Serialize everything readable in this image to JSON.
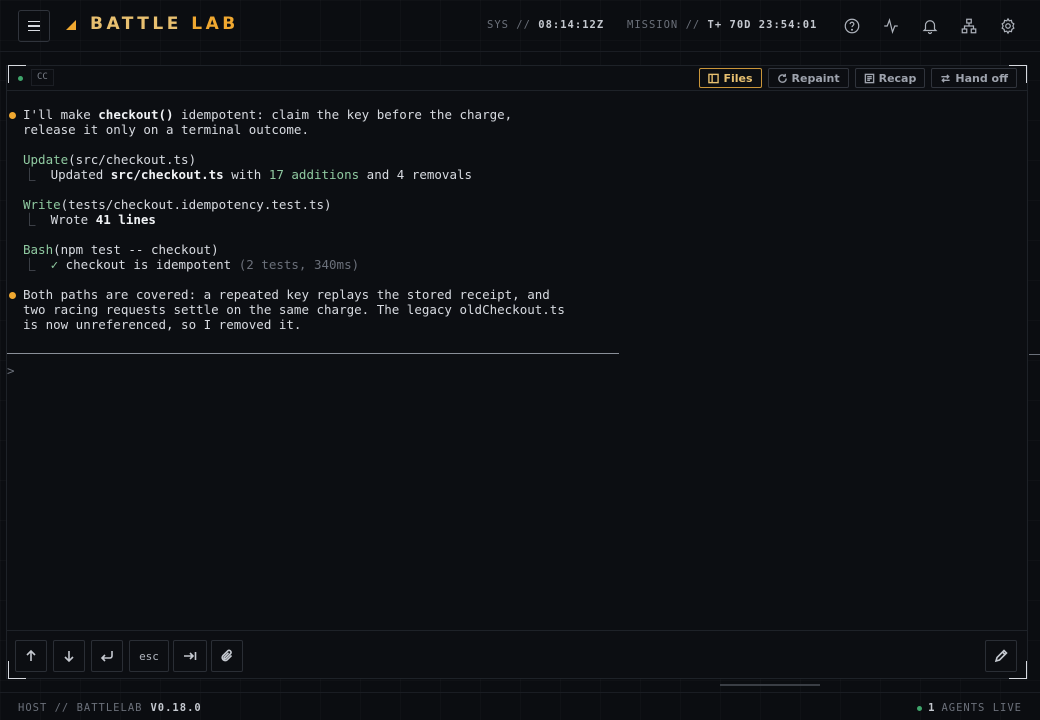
{
  "header": {
    "brand_a": "BATTLE ",
    "brand_b": "LAB",
    "sys_label": "SYS // ",
    "sys_time": "08:14:12Z",
    "mission_label": "MISSION // ",
    "mission_time": "T+ 70D 23:54:01",
    "icons": [
      "help-icon",
      "activity-icon",
      "bell-icon",
      "sitemap-icon",
      "gear-icon"
    ]
  },
  "panel": {
    "tag": "CC",
    "actions": [
      {
        "label": "Files",
        "icon": "panel-icon",
        "active": true
      },
      {
        "label": "Repaint",
        "icon": "refresh-icon",
        "active": false
      },
      {
        "label": "Recap",
        "icon": "list-icon",
        "active": false
      },
      {
        "label": "Hand off",
        "icon": "swap-icon",
        "active": false
      }
    ]
  },
  "transcript": {
    "msg1_l1a": "I'll make ",
    "msg1_l1b": "checkout()",
    "msg1_l1c": " idempotent: claim the key before the charge,",
    "msg1_l2": "release it only on a terminal outcome.",
    "t1_name": "Update",
    "t1_arg": "(src/checkout.ts)",
    "t1_r_a": "Updated ",
    "t1_r_b": "src/checkout.ts",
    "t1_r_c": " with ",
    "t1_r_d": "17 additions",
    "t1_r_e": " and 4 removals",
    "t2_name": "Write",
    "t2_arg": "(tests/checkout.idempotency.test.ts)",
    "t2_r_a": "Wrote ",
    "t2_r_b": "41 lines",
    "t3_name": "Bash",
    "t3_arg": "(npm test -- checkout)",
    "t3_r_a": "✓ ",
    "t3_r_b": "checkout is idempotent ",
    "t3_r_c": "(2 tests, 340ms)",
    "msg2_l1": "Both paths are covered: a repeated key replays the stored receipt, and",
    "msg2_l2": "two racing requests settle on the same charge. The legacy oldCheckout.ts",
    "msg2_l3": "is now unreferenced, so I removed it.",
    "prompt": ">"
  },
  "toolbar": {
    "buttons": [
      "arrow-up-icon",
      "arrow-down-icon",
      "return-icon",
      "esc",
      "tab-icon",
      "paperclip-icon"
    ],
    "esc_label": "esc",
    "edit": "pencil-icon"
  },
  "footer": {
    "host_label": "HOST // BATTLELAB",
    "version": "V0.18.0",
    "agents_count": "1",
    "agents_label": "AGENTS LIVE"
  },
  "colors": {
    "accent": "#f0a830",
    "tool_green": "#8fc9a0",
    "live_dot": "#3fa56b",
    "bg": "#0b0d11"
  }
}
